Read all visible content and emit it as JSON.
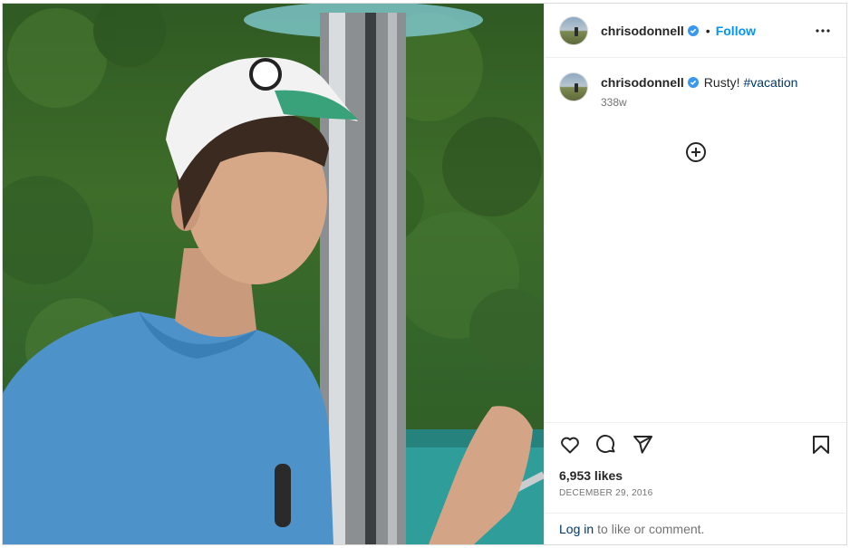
{
  "post": {
    "username": "chrisodonnell",
    "follow_label": "Follow",
    "separator": "•",
    "caption_text": "Rusty!",
    "caption_hashtag": "#vacation",
    "caption_time": "338w",
    "likes": "6,953 likes",
    "date": "DECEMBER 29, 2016",
    "login_link": "Log in",
    "login_rest": "to like or comment."
  },
  "icons": {
    "verified": "verified-badge-icon",
    "more": "more-options-icon",
    "load_more": "plus-circle-icon",
    "like": "heart-icon",
    "comment": "comment-icon",
    "share": "paper-plane-icon",
    "save": "bookmark-icon"
  },
  "colors": {
    "accent": "#0095f6",
    "verified": "#3897f0",
    "link": "#00376b",
    "muted": "#737373"
  }
}
